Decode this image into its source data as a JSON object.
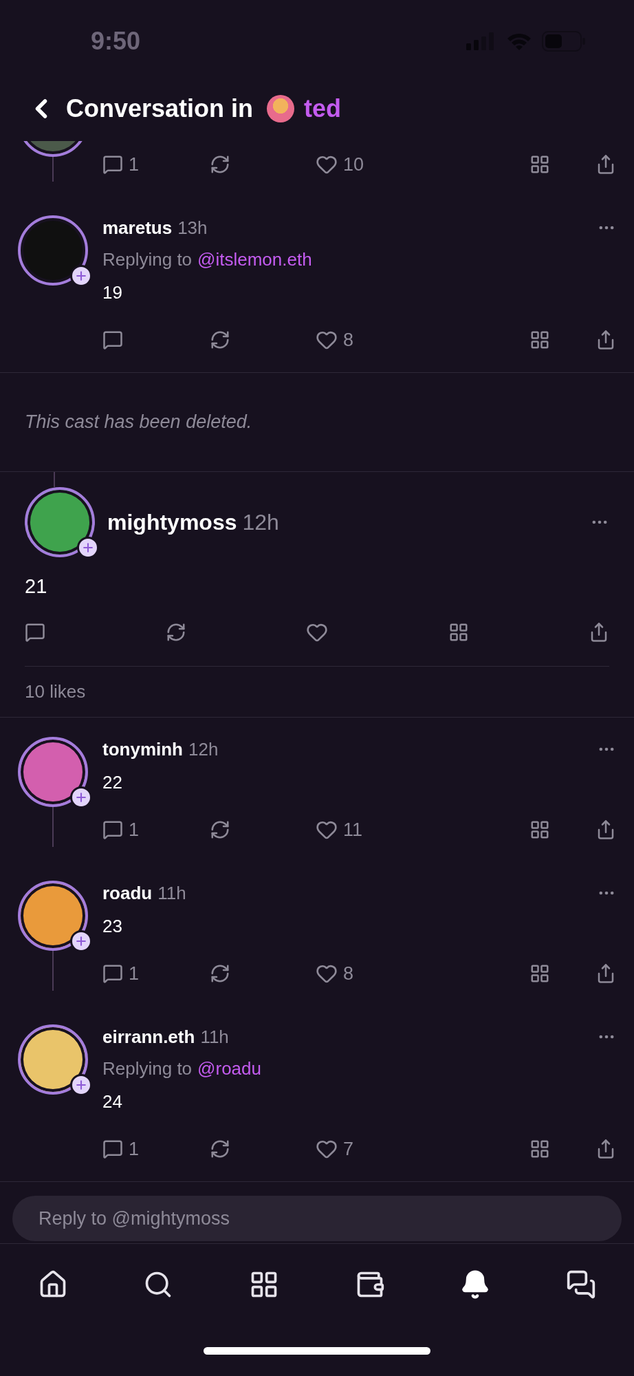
{
  "status_bar": {
    "time": "9:50"
  },
  "header": {
    "title": "Conversation in",
    "channel": "ted"
  },
  "thread_above": [
    {
      "kind": "cut",
      "reply_count": "1",
      "like_count": "10"
    },
    {
      "kind": "cast",
      "author": "maretus",
      "time": "13h",
      "replying_label": "Replying to",
      "replying_to": "@itslemon.eth",
      "text": "19",
      "like_count": "8"
    }
  ],
  "deleted_notice": "This cast has been deleted.",
  "main_cast": {
    "author": "mightymoss",
    "time": "12h",
    "text": "21",
    "likes_summary": "10 likes"
  },
  "replies": [
    {
      "kind": "cast",
      "author": "tonyminh",
      "time": "12h",
      "text": "22",
      "reply_count": "1",
      "like_count": "11"
    },
    {
      "kind": "cast",
      "author": "roadu",
      "time": "11h",
      "text": "23",
      "reply_count": "1",
      "like_count": "8"
    },
    {
      "kind": "cast",
      "author": "eirrann.eth",
      "time": "11h",
      "replying_label": "Replying to",
      "replying_to": "@roadu",
      "text": "24",
      "reply_count": "1",
      "like_count": "7"
    }
  ],
  "reply_field": {
    "placeholder": "Reply to @mightymoss"
  },
  "nav": [
    {
      "kind": "home",
      "selected": false
    },
    {
      "kind": "search",
      "selected": false
    },
    {
      "kind": "apps",
      "selected": false
    },
    {
      "kind": "wallet",
      "selected": false
    },
    {
      "kind": "notifications",
      "selected": true
    },
    {
      "kind": "messages",
      "selected": false
    }
  ]
}
